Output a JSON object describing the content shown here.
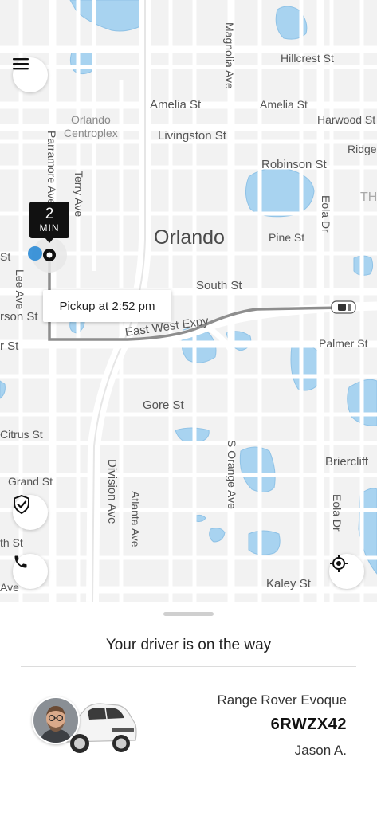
{
  "map": {
    "city_label": "Orlando",
    "street_labels": {
      "hillcrest": "Hillcrest St",
      "magnolia": "Magnolia Ave",
      "amelia_left": "Amelia St",
      "amelia_right": "Amelia St",
      "harwood": "Harwood St",
      "orlando_centroplex_1": "Orlando",
      "orlando_centroplex_2": "Centroplex",
      "livingston": "Livingston St",
      "ridge": "Ridge",
      "robinson": "Robinson St",
      "parramore": "Parramore Ave",
      "terry": "Terry Ave",
      "eola_top": "Eola Dr",
      "pine": "Pine St",
      "st_left": "St",
      "lee": "Lee Ave",
      "south": "South St",
      "rson": "rson St",
      "east_west": "East West Expy",
      "r_st": "r St",
      "palmer": "Palmer St",
      "gore": "Gore St",
      "citrus": "Citrus St",
      "s_orange": "S Orange Ave",
      "briercliff": "Briercliff",
      "division": "Division Ave",
      "grand": "Grand St",
      "atlanta": "Atlanta Ave",
      "eola_bottom": "Eola Dr",
      "th_st": "th St",
      "ave_left": "Ave",
      "kaley": "Kaley St",
      "th_right": "TH"
    },
    "eta_value": "2",
    "eta_unit": "MIN",
    "pickup_text": "Pickup at 2:52 pm",
    "route_color": "#8e8e8e",
    "water_color": "#a8d3f0",
    "pickup_dot_color": "#2b8bd6"
  },
  "controls": {
    "menu_icon": "hamburger-menu-icon",
    "safety_icon": "shield-check-icon",
    "phone_icon": "phone-icon",
    "locate_icon": "crosshair-locate-icon"
  },
  "sheet": {
    "title": "Your driver is on the way",
    "car_model": "Range Rover Evoque",
    "plate": "6RWZX42",
    "driver_name": "Jason A."
  }
}
